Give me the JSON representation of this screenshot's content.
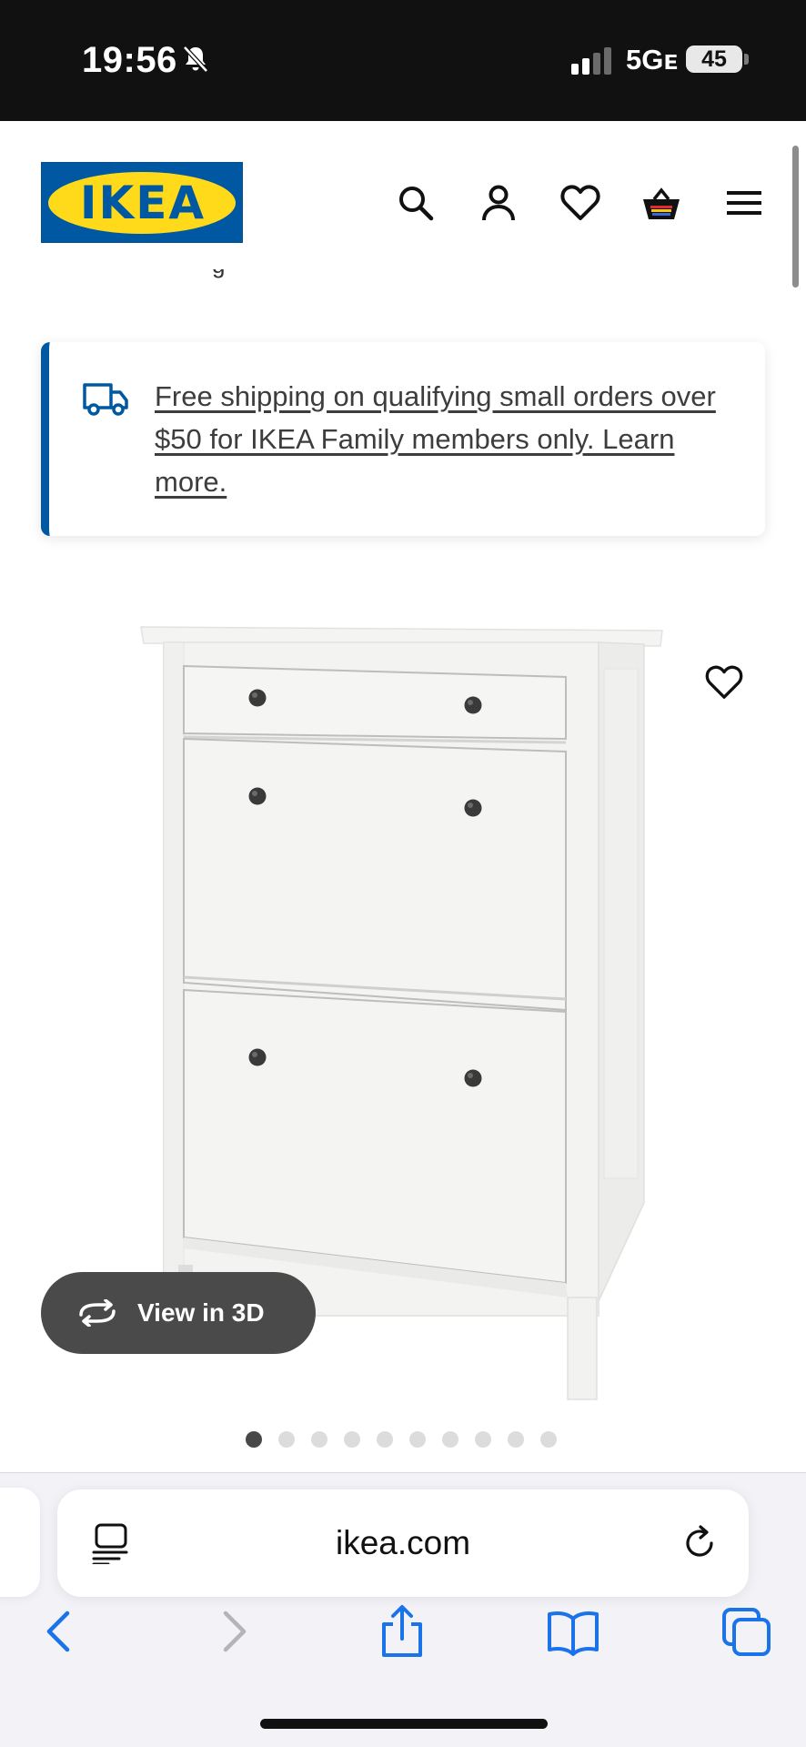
{
  "status_bar": {
    "time": "19:56",
    "network": "5Gᴇ",
    "battery": "45"
  },
  "header": {
    "logo_text": "IKEA",
    "brand_colors": {
      "blue": "#0058a3",
      "yellow": "#ffda1a"
    },
    "icons": [
      "search-icon",
      "account-icon",
      "favorites-icon",
      "cart-icon",
      "menu-icon"
    ],
    "partial_text": "g"
  },
  "shipping_banner": {
    "text": "Free shipping on qualifying small orders over $50 for IKEA Family members only. Learn more.",
    "accent_color": "#0058a3"
  },
  "product_gallery": {
    "view3d_label": "View in 3D",
    "dot_count": 10,
    "active_dot_index": 0
  },
  "browser": {
    "url": "ikea.com",
    "toolbar_icons": [
      "back-icon",
      "forward-icon",
      "share-icon",
      "bookmarks-icon",
      "tabs-icon"
    ],
    "accent_color": "#1a73e8"
  }
}
